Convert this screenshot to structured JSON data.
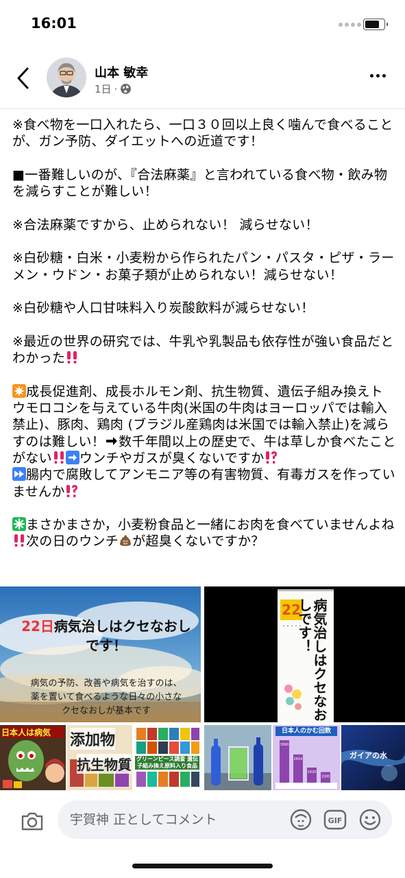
{
  "status_bar": {
    "time": "16:01"
  },
  "post": {
    "author": "山本 敏幸",
    "age": "1日",
    "separator": "·",
    "paragraphs": [
      "※食べ物を一口入れたら、一口３０回以上良く噛んで食べることが、ガン予防、ダイエットへの近道です！",
      "■一番難しいのが、『合法麻薬』と言われている食べ物・飲み物を減らすことが難しい！",
      "※合法麻薬ですから、止められない！ 減らせない！",
      "※白砂糖・白米・小麦粉から作られたパン・パスタ・ピザ・ラーメン・ウドン・お菓子類が止められない！減らせない！",
      "※白砂糖や人口甘味料入り炭酸飲料が減らせない！"
    ],
    "p6a": "※最近の世界の研究では、牛乳や乳製品も依存性が強い食品だとわかった",
    "p7a": "成長促進剤、成長ホルモン剤、抗生物質、遺伝子組み換えトウモロコシを与えている牛肉(米国の牛肉はヨーロッパでは輸入禁止)、豚肉、鶏肉 (ブラジル産鶏肉は米国では輸入禁止)を減らすのは難しい！",
    "p7b": "数千年間以上の歴史で、牛は草しか食べたことがない",
    "p7c": "ウンチやガスが臭くないですか",
    "p7d": "腸内で腐敗してアンモニア等の有害物質、有毒ガスを作っていませんか",
    "p8a": "まさかまさか，小麦粉食品と一緒にお肉を食べていませんよね",
    "p8b": "次の日のウンチ",
    "p8c": "が超臭くないですか？",
    "images": {
      "img1_title_a": "22日",
      "img1_title_b": "病気治しはクセなおし",
      "img1_title_c": "です！",
      "img1_caption_1": "病気の予防、改善や病気を治すのは、",
      "img1_caption_2": "薬を置いて食べるような日々の小さな",
      "img1_caption_3": "クセなおしが基本です",
      "img2_day": "22",
      "img2_vertical": "病気治しはクセなおしです！",
      "img3_text": "日本人は病気",
      "img4_text_1": "添加物",
      "img4_text_2": "抗生物質",
      "img5_text": "グリーンピース調査 遺伝子組み換え原料入り食品",
      "img7_title": "日本人のかむ回数",
      "img7_bars": [
        3990,
        2654,
        1420,
        1000
      ],
      "img8_text": "ガイアの水"
    }
  },
  "comment": {
    "placeholder": "宇賀神 正としてコメント",
    "gif_label": "GIF"
  },
  "colors": {
    "red_mark": "#e0245e",
    "orange": "#f7941d",
    "blue_icon": "#3b82f6",
    "green_icon": "#1db954",
    "meta": "#65676b"
  }
}
